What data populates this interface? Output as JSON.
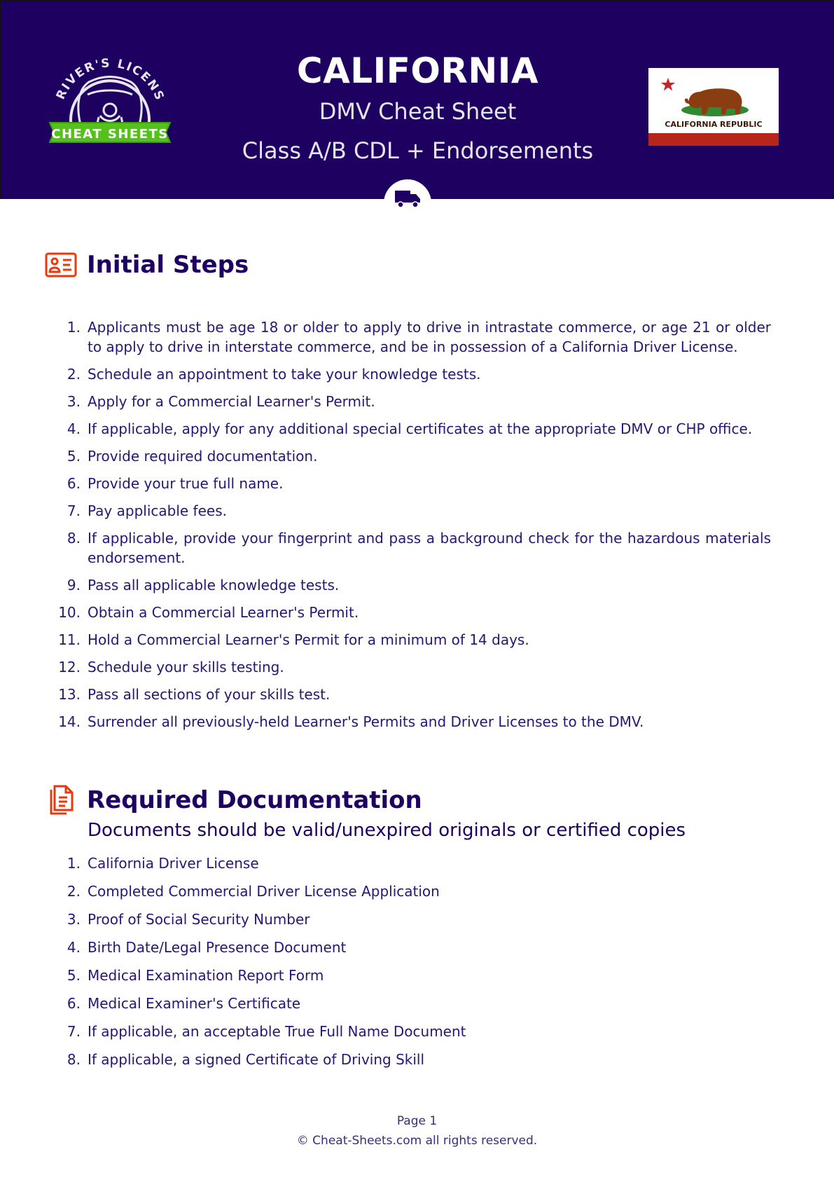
{
  "header": {
    "logo": {
      "arc_text": "DRIVER'S LICENSE",
      "banner_text": "CHEAT SHEETS",
      "banner_color": "#55c21b"
    },
    "title": "CALIFORNIA",
    "subtitle": "DMV Cheat Sheet",
    "subtitle2": "Class A/B CDL + Endorsements",
    "flag": {
      "caption": "CALIFORNIA REPUBLIC"
    },
    "badge_icon": "truck-icon",
    "background_color": "#1e0060"
  },
  "sections": [
    {
      "title": "Initial Steps",
      "icon": "id-card-icon",
      "items": [
        {
          "num": "1.",
          "text": "Applicants must be age 18 or older to apply to drive in intrastate commerce, or age 21 or older to apply to drive in interstate commerce, and be in possession of a California Driver License."
        },
        {
          "num": "2.",
          "text": "Schedule an appointment to take your knowledge tests."
        },
        {
          "num": "3.",
          "text": "Apply for a Commercial Learner's Permit."
        },
        {
          "num": "4.",
          "text": "If applicable, apply for any additional special certificates at the appropriate DMV or CHP office."
        },
        {
          "num": "5.",
          "text": "Provide required documentation."
        },
        {
          "num": "6.",
          "text": "Provide your true full name."
        },
        {
          "num": "7.",
          "text": "Pay applicable fees."
        },
        {
          "num": "8.",
          "text": "If applicable, provide your fingerprint and pass a background check for the hazardous materials endorsement."
        },
        {
          "num": "9.",
          "text": "Pass all applicable knowledge tests."
        },
        {
          "num": "10.",
          "text": "Obtain a Commercial Learner's Permit."
        },
        {
          "num": "11.",
          "text": "Hold a Commercial Learner's Permit for a minimum of 14 days."
        },
        {
          "num": "12.",
          "text": "Schedule your skills testing."
        },
        {
          "num": "13.",
          "text": "Pass all sections of your skills test."
        },
        {
          "num": "14.",
          "text": "Surrender all previously-held Learner's Permits and Driver Licenses to the DMV."
        }
      ]
    },
    {
      "title": "Required Documentation",
      "subtitle": "Documents should be valid/unexpired originals or certified copies",
      "icon": "documents-icon",
      "items": [
        {
          "num": "1.",
          "text": "California Driver License"
        },
        {
          "num": "2.",
          "text": "Completed Commercial Driver License Application"
        },
        {
          "num": "3.",
          "text": "Proof of Social Security Number"
        },
        {
          "num": "4.",
          "text": "Birth Date/Legal Presence Document"
        },
        {
          "num": "5.",
          "text": "Medical Examination Report Form"
        },
        {
          "num": "6.",
          "text": "Medical Examiner's Certificate"
        },
        {
          "num": "7.",
          "text": "If applicable, an acceptable True Full Name Document"
        },
        {
          "num": "8.",
          "text": "If applicable, a signed Certificate of Driving Skill"
        }
      ]
    }
  ],
  "footer": {
    "page": "Page 1",
    "copyright": "©  Cheat-Sheets.com all rights reserved."
  },
  "colors": {
    "accent_icon": "#e8390e",
    "heading": "#1e0060",
    "body_text": "#2a1670"
  }
}
